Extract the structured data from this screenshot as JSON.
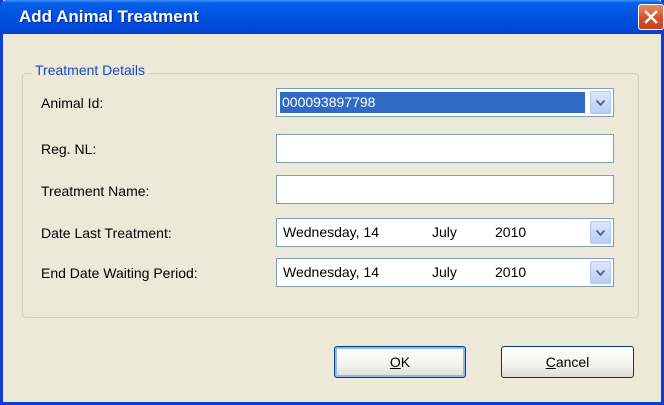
{
  "window": {
    "title": "Add Animal Treatment"
  },
  "group": {
    "label": "Treatment Details"
  },
  "fields": {
    "animal_id": {
      "label": "Animal Id:",
      "value": "000093897798"
    },
    "reg_nl": {
      "label": "Reg. NL:",
      "value": ""
    },
    "treatment_name": {
      "label": "Treatment Name:",
      "value": ""
    },
    "date_last_treatment": {
      "label": "Date Last Treatment:",
      "weekday": "Wednesday, 14",
      "month": "July",
      "year": "2010"
    },
    "end_date_waiting": {
      "label": "End Date Waiting Period:",
      "weekday": "Wednesday, 14",
      "month": "July",
      "year": "2010"
    }
  },
  "buttons": {
    "ok": {
      "mnemonic": "O",
      "rest": "K"
    },
    "cancel": {
      "mnemonic": "C",
      "rest": "ancel"
    }
  },
  "colors": {
    "title_bar": "#0054e3",
    "selection": "#316ac5",
    "group_label": "#1b47c9",
    "close_button": "#d4502b"
  },
  "icons": {
    "close": "close-icon",
    "dropdown": "chevron-down-icon"
  }
}
